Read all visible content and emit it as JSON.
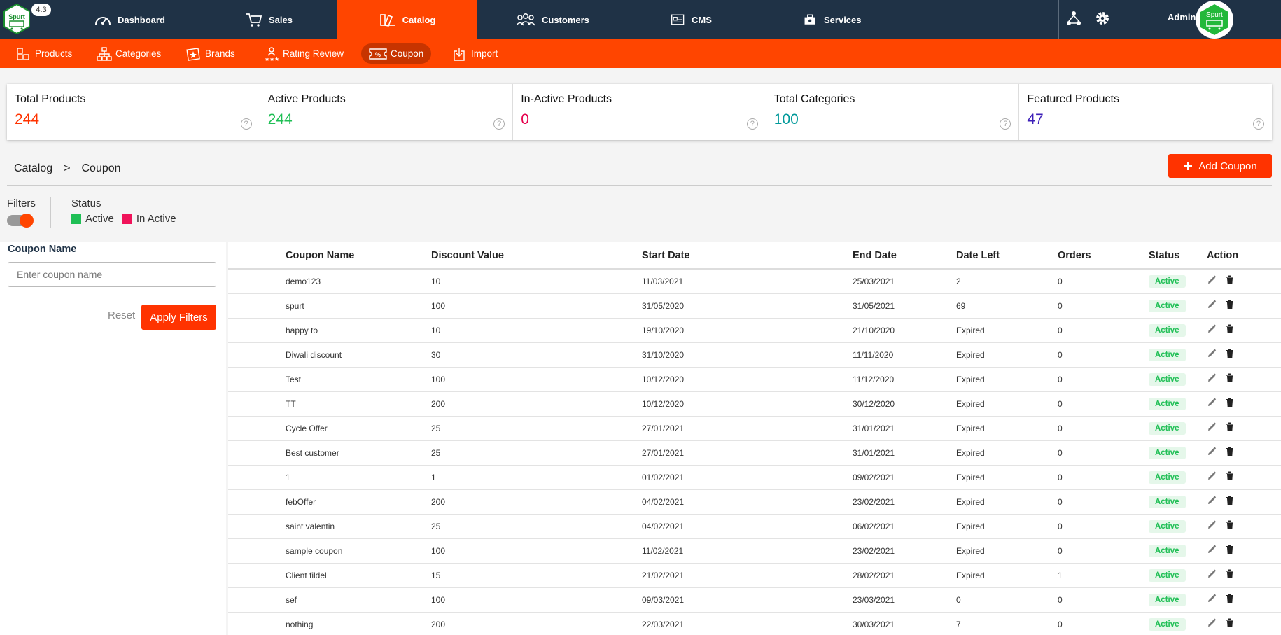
{
  "brand": {
    "version": "4.3",
    "logo_text": "Spurt"
  },
  "nav": {
    "items": [
      {
        "label": "Dashboard",
        "icon": "gauge-icon"
      },
      {
        "label": "Sales",
        "icon": "cart-icon"
      },
      {
        "label": "Catalog",
        "icon": "catalog-icon",
        "active": true
      },
      {
        "label": "Customers",
        "icon": "users-icon"
      },
      {
        "label": "CMS",
        "icon": "cms-icon"
      },
      {
        "label": "Services",
        "icon": "services-icon"
      }
    ],
    "admin_label": "Admin"
  },
  "subnav": {
    "items": [
      {
        "label": "Products"
      },
      {
        "label": "Categories"
      },
      {
        "label": "Brands"
      },
      {
        "label": "Rating Review"
      },
      {
        "label": "Coupon",
        "active": true
      },
      {
        "label": "Import"
      }
    ]
  },
  "stats": [
    {
      "title": "Total Products",
      "value": "244",
      "color": "#ff3300"
    },
    {
      "title": "Active Products",
      "value": "244",
      "color": "#1fbf55"
    },
    {
      "title": "In-Active Products",
      "value": "0",
      "color": "#e6004c"
    },
    {
      "title": "Total Categories",
      "value": "100",
      "color": "#00999a"
    },
    {
      "title": "Featured Products",
      "value": "47",
      "color": "#3c1fb8"
    }
  ],
  "breadcrumb": {
    "parent": "Catalog",
    "separator": ">",
    "current": "Coupon"
  },
  "add_button": "Add Coupon",
  "filters": {
    "label": "Filters",
    "status_label": "Status",
    "legend_active": "Active",
    "legend_inactive": "In Active",
    "active_color": "#1fbf55",
    "inactive_color": "#f0135a",
    "coupon_name_label": "Coupon Name",
    "coupon_name_placeholder": "Enter coupon name",
    "reset": "Reset",
    "apply": "Apply Filters"
  },
  "table": {
    "headers": [
      "Coupon Name",
      "Discount Value",
      "Start Date",
      "End Date",
      "Date Left",
      "Orders",
      "Status",
      "Action"
    ],
    "rows": [
      [
        "demo123",
        "10",
        "11/03/2021",
        "25/03/2021",
        "2",
        "0",
        "Active"
      ],
      [
        "spurt",
        "100",
        "31/05/2020",
        "31/05/2021",
        "69",
        "0",
        "Active"
      ],
      [
        "happy to",
        "10",
        "19/10/2020",
        "21/10/2020",
        "Expired",
        "0",
        "Active"
      ],
      [
        "Diwali discount",
        "30",
        "31/10/2020",
        "11/11/2020",
        "Expired",
        "0",
        "Active"
      ],
      [
        "Test",
        "100",
        "10/12/2020",
        "11/12/2020",
        "Expired",
        "0",
        "Active"
      ],
      [
        "TT",
        "200",
        "10/12/2020",
        "30/12/2020",
        "Expired",
        "0",
        "Active"
      ],
      [
        "Cycle Offer",
        "25",
        "27/01/2021",
        "31/01/2021",
        "Expired",
        "0",
        "Active"
      ],
      [
        "Best customer",
        "25",
        "27/01/2021",
        "31/01/2021",
        "Expired",
        "0",
        "Active"
      ],
      [
        "1",
        "1",
        "01/02/2021",
        "09/02/2021",
        "Expired",
        "0",
        "Active"
      ],
      [
        "febOffer",
        "200",
        "04/02/2021",
        "23/02/2021",
        "Expired",
        "0",
        "Active"
      ],
      [
        "saint valentin",
        "25",
        "04/02/2021",
        "06/02/2021",
        "Expired",
        "0",
        "Active"
      ],
      [
        "sample coupon",
        "100",
        "11/02/2021",
        "23/02/2021",
        "Expired",
        "0",
        "Active"
      ],
      [
        "Client fildel",
        "15",
        "21/02/2021",
        "28/02/2021",
        "Expired",
        "1",
        "Active"
      ],
      [
        "sef",
        "100",
        "09/03/2021",
        "23/03/2021",
        "0",
        "0",
        "Active"
      ],
      [
        "nothing",
        "200",
        "22/03/2021",
        "30/03/2021",
        "7",
        "0",
        "Active"
      ]
    ]
  }
}
